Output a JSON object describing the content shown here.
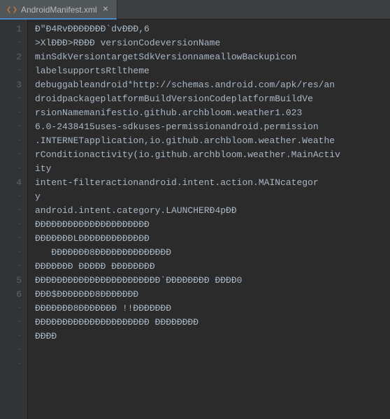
{
  "tab": {
    "filename": "AndroidManifest.xml",
    "close_glyph": "×"
  },
  "gutter": [
    "1",
    "·",
    "2",
    "·",
    "3",
    "·",
    "·",
    "·",
    "·",
    "·",
    "·",
    "4",
    "·",
    "·",
    "·",
    "·",
    "·",
    "·",
    "5",
    "6",
    "·",
    "·",
    "·",
    "·",
    "·"
  ],
  "code": [
    "Ð\"Ð4RvÐÐÐÐÐÐÐ`dvÐÐÐ,6",
    ">XlÐÐÐ>RÐÐÐ versionCodeversionName",
    "minSdkVersiontargetSdkVersionnameallowBackupicon",
    "labelsupportsRtltheme",
    "debuggableandroid*http://schemas.android.com/apk/res/an",
    "droidpackageplatformBuildVersionCodeplatformBuildVe",
    "rsionNamemanifestio.github.archbloom.weather1.023",
    "6.0-2438415uses-sdkuses-permissionandroid.permission",
    ".INTERNETapplication,io.github.archbloom.weather.Weathe",
    "rConditionactivity(io.github.archbloom.weather.MainActiv",
    "ity",
    "intent-filteractionandroid.intent.action.MAINcategor",
    "y",
    "android.intent.category.LAUNCHERÐ4pÐÐ",
    "ÐÐÐÐÐÐÐÐÐÐÐÐÐÐÐÐÐÐÐÐÐ",
    "ÐÐÐÐÐÐÐLÐÐÐÐÐÐÐÐÐÐÐÐÐ",
    "   ÐÐÐÐÐÐÐ8ÐÐÐÐÐÐÐÐÐÐÐÐÐÐ",
    "ÐÐÐÐÐÐÐ ÐÐÐÐÐ ÐÐÐÐÐÐÐÐ",
    "ÐÐÐÐÐÐÐÐÐÐÐÐÐÐÐÐÐÐÐÐÐÐÐ`ÐÐÐÐÐÐÐÐ ÐÐÐÐ0",
    "ÐÐÐ$ÐÐÐÐÐÐÐ8ÐÐÐÐÐÐÐ",
    "ÐÐÐÐÐÐÐ8ÐÐÐÐÐÐÐ !!ÐÐÐÐÐÐÐ",
    "ÐÐÐÐÐÐÐÐÐÐÐÐÐÐÐÐÐÐÐÐÐ ÐÐÐÐÐÐÐÐ",
    "ÐÐÐÐ",
    "",
    ""
  ]
}
